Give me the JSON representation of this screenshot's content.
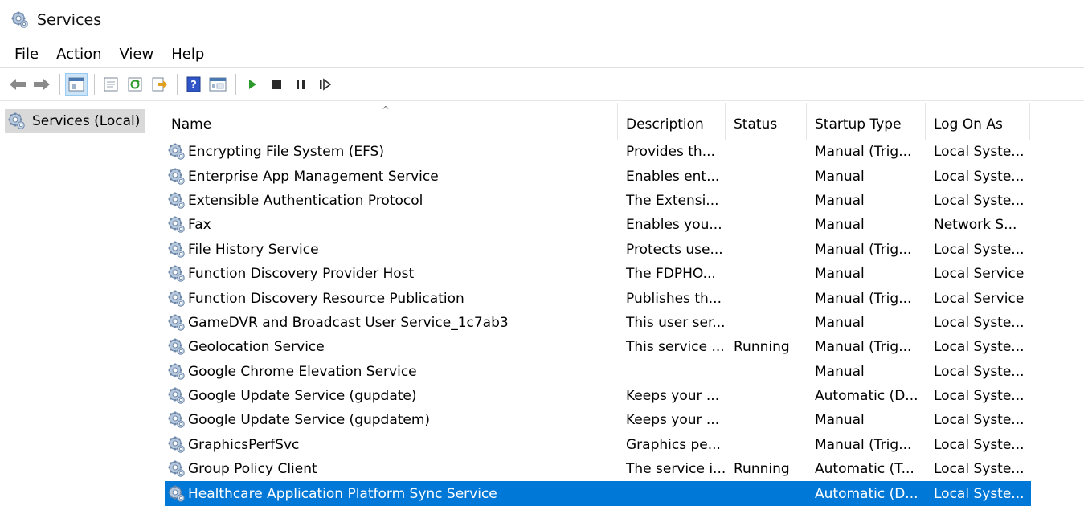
{
  "window": {
    "title": "Services"
  },
  "menu": [
    "File",
    "Action",
    "View",
    "Help"
  ],
  "toolbar": {
    "icons": [
      "back-arrow-icon",
      "forward-arrow-icon",
      "show-console-tree-icon",
      "properties-icon",
      "refresh-icon",
      "export-list-icon",
      "help-icon",
      "view-icon",
      "start-service-icon",
      "stop-service-icon",
      "pause-service-icon",
      "resume-service-icon"
    ]
  },
  "tree": {
    "root_label": "Services (Local)"
  },
  "list": {
    "columns": [
      "Name",
      "Description",
      "Status",
      "Startup Type",
      "Log On As"
    ],
    "sort_indicator": "^",
    "rows": [
      {
        "name": "Encrypting File System (EFS)",
        "description": "Provides th...",
        "status": "",
        "startup": "Manual (Trig...",
        "logon": "Local Syste..."
      },
      {
        "name": "Enterprise App Management Service",
        "description": "Enables ent...",
        "status": "",
        "startup": "Manual",
        "logon": "Local Syste..."
      },
      {
        "name": "Extensible Authentication Protocol",
        "description": "The Extensi...",
        "status": "",
        "startup": "Manual",
        "logon": "Local Syste..."
      },
      {
        "name": "Fax",
        "description": "Enables you...",
        "status": "",
        "startup": "Manual",
        "logon": "Network S..."
      },
      {
        "name": "File History Service",
        "description": "Protects use...",
        "status": "",
        "startup": "Manual (Trig...",
        "logon": "Local Syste..."
      },
      {
        "name": "Function Discovery Provider Host",
        "description": "The FDPHO...",
        "status": "",
        "startup": "Manual",
        "logon": "Local Service"
      },
      {
        "name": "Function Discovery Resource Publication",
        "description": "Publishes th...",
        "status": "",
        "startup": "Manual (Trig...",
        "logon": "Local Service"
      },
      {
        "name": "GameDVR and Broadcast User Service_1c7ab3",
        "description": "This user ser...",
        "status": "",
        "startup": "Manual",
        "logon": "Local Syste..."
      },
      {
        "name": "Geolocation Service",
        "description": "This service ...",
        "status": "Running",
        "startup": "Manual (Trig...",
        "logon": "Local Syste..."
      },
      {
        "name": "Google Chrome Elevation Service",
        "description": "",
        "status": "",
        "startup": "Manual",
        "logon": "Local Syste..."
      },
      {
        "name": "Google Update Service (gupdate)",
        "description": "Keeps your ...",
        "status": "",
        "startup": "Automatic (D...",
        "logon": "Local Syste..."
      },
      {
        "name": "Google Update Service (gupdatem)",
        "description": "Keeps your ...",
        "status": "",
        "startup": "Manual",
        "logon": "Local Syste..."
      },
      {
        "name": "GraphicsPerfSvc",
        "description": "Graphics pe...",
        "status": "",
        "startup": "Manual (Trig...",
        "logon": "Local Syste..."
      },
      {
        "name": "Group Policy Client",
        "description": "The service i...",
        "status": "Running",
        "startup": "Automatic (T...",
        "logon": "Local Syste..."
      },
      {
        "name": "Healthcare Application Platform Sync Service",
        "description": "",
        "status": "",
        "startup": "Automatic (D...",
        "logon": "Local Syste...",
        "selected": true
      }
    ]
  },
  "colors": {
    "selection": "#0078d7",
    "tree_selected": "#d9d9d9",
    "play_green": "#2e9a2e"
  }
}
